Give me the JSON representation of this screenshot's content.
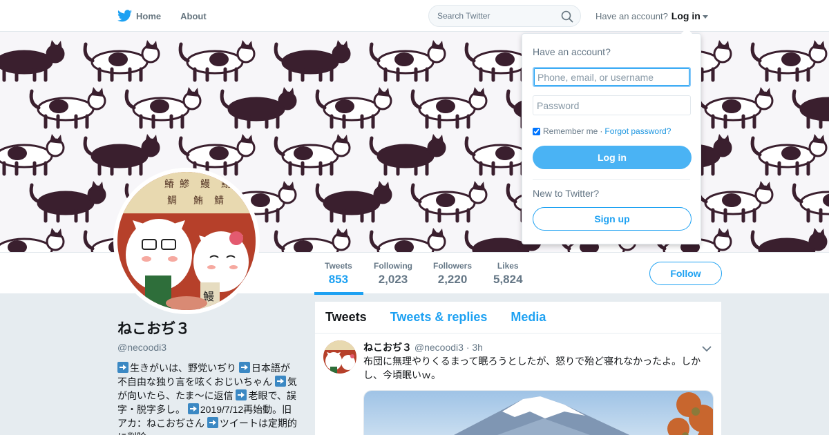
{
  "nav": {
    "logo_icon": "twitter-bird-icon",
    "home_label": "Home",
    "about_label": "About",
    "search_placeholder": "Search Twitter",
    "search_icon": "search-icon",
    "have_account": "Have an account?",
    "login_label": "Log in"
  },
  "banner": {
    "description_icon": "cat-pattern-banner"
  },
  "stats": [
    {
      "label": "Tweets",
      "value": "853"
    },
    {
      "label": "Following",
      "value": "2,023"
    },
    {
      "label": "Followers",
      "value": "2,220"
    },
    {
      "label": "Likes",
      "value": "5,824"
    }
  ],
  "follow_label": "Follow",
  "profile": {
    "name": "ねこおぢ３",
    "handle": "@necoodi3",
    "bio_parts": [
      "生きがいは、野党いぢり ",
      "日本語が不自由な独り言を呟くおじいちゃん ",
      "気が向いたら、たま～に返信 ",
      "老眼で、誤字・脱字多し。 ",
      "2019/7/12再始動。旧アカ：ねこおぢさん ",
      "ツイートは定期的に削除"
    ]
  },
  "timeline": {
    "tabs": [
      "Tweets",
      "Tweets & replies",
      "Media"
    ],
    "tweet": {
      "name": "ねこおぢ３",
      "handle": "@necoodi3",
      "time": "· 3h",
      "text": "布団に無理やりくるまって眠ろうとしたが、怒りで殆ど寝れなかったよ。しかし、今頃眠いｗ。"
    }
  },
  "login": {
    "title": "Have an account?",
    "username_placeholder": "Phone, email, or username",
    "password_placeholder": "Password",
    "remember": "Remember me",
    "separator": "·",
    "forgot": "Forgot password?",
    "login_button": "Log in",
    "new_label": "New to Twitter?",
    "signup_button": "Sign up"
  },
  "colors": {
    "accent": "#1da1f2",
    "cat_dark": "#3a1f2e"
  }
}
